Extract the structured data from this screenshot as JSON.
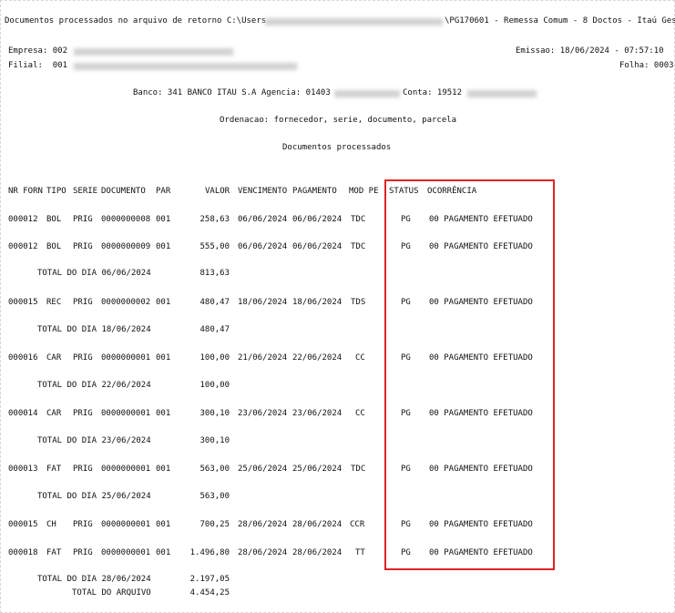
{
  "header": {
    "title_left": "Documentos processados no arquivo de retorno C:\\Users",
    "title_right": "\\PG170601 - Remessa Comum - 8 Doctos - Itaú Ges",
    "empresa_label": "Empresa: 002",
    "filial_label": "Filial:  001",
    "emissao": "Emissao: 18/06/2024 - 07:57:10",
    "folha": "Folha: 0003",
    "banco_label": "Banco: 341 BANCO ITAU S.A Agencia: 01403",
    "conta_label": "Conta: 19512",
    "ordenacao": "Ordenacao: fornecedor, serie, documento, parcela",
    "subtitle": "Documentos processados"
  },
  "columns": {
    "nr_forn": "NR FORN",
    "tipo": "TIPO",
    "serie": "SERIE",
    "documento": "DOCUMENTO",
    "par": "PAR",
    "valor": "VALOR",
    "vencimento": "VENCIMENTO",
    "pagamento": "PAGAMENTO",
    "mod_pe": "MOD PE",
    "status": "STATUS",
    "ocorrencia": "OCORRÊNCIA"
  },
  "rows": [
    {
      "kind": "doc",
      "forn": "000012",
      "tipo": "BOL",
      "serie": "PRIG",
      "doc": "0000000008",
      "par": "001",
      "valor": "258,63",
      "venc": "06/06/2024",
      "pag": "06/06/2024",
      "mod": "TDC",
      "status": "PG",
      "ocorr": "00 PAGAMENTO EFETUADO"
    },
    {
      "kind": "doc",
      "forn": "000012",
      "tipo": "BOL",
      "serie": "PRIG",
      "doc": "0000000009",
      "par": "001",
      "valor": "555,00",
      "venc": "06/06/2024",
      "pag": "06/06/2024",
      "mod": "TDC",
      "status": "PG",
      "ocorr": "00 PAGAMENTO EFETUADO"
    },
    {
      "kind": "total",
      "label": "TOTAL DO DIA 06/06/2024",
      "valor": "813,63"
    },
    {
      "kind": "doc",
      "forn": "000015",
      "tipo": "REC",
      "serie": "PRIG",
      "doc": "0000000002",
      "par": "001",
      "valor": "480,47",
      "venc": "18/06/2024",
      "pag": "18/06/2024",
      "mod": "TDS",
      "status": "PG",
      "ocorr": "00 PAGAMENTO EFETUADO"
    },
    {
      "kind": "total",
      "label": "TOTAL DO DIA 18/06/2024",
      "valor": "480,47"
    },
    {
      "kind": "doc",
      "forn": "000016",
      "tipo": "CAR",
      "serie": "PRIG",
      "doc": "0000000001",
      "par": "001",
      "valor": "100,00",
      "venc": "21/06/2024",
      "pag": "22/06/2024",
      "mod": "CC",
      "status": "PG",
      "ocorr": "00 PAGAMENTO EFETUADO"
    },
    {
      "kind": "total",
      "label": "TOTAL DO DIA 22/06/2024",
      "valor": "100,00"
    },
    {
      "kind": "doc",
      "forn": "000014",
      "tipo": "CAR",
      "serie": "PRIG",
      "doc": "0000000001",
      "par": "001",
      "valor": "300,10",
      "venc": "23/06/2024",
      "pag": "23/06/2024",
      "mod": "CC",
      "status": "PG",
      "ocorr": "00 PAGAMENTO EFETUADO"
    },
    {
      "kind": "total",
      "label": "TOTAL DO DIA 23/06/2024",
      "valor": "300,10"
    },
    {
      "kind": "doc",
      "forn": "000013",
      "tipo": "FAT",
      "serie": "PRIG",
      "doc": "0000000001",
      "par": "001",
      "valor": "563,00",
      "venc": "25/06/2024",
      "pag": "25/06/2024",
      "mod": "TDC",
      "status": "PG",
      "ocorr": "00 PAGAMENTO EFETUADO"
    },
    {
      "kind": "total",
      "label": "TOTAL DO DIA 25/06/2024",
      "valor": "563,00"
    },
    {
      "kind": "doc",
      "forn": "000015",
      "tipo": "CH",
      "serie": "PRIG",
      "doc": "0000000001",
      "par": "001",
      "valor": "700,25",
      "venc": "28/06/2024",
      "pag": "28/06/2024",
      "mod": "CCR",
      "status": "PG",
      "ocorr": "00 PAGAMENTO EFETUADO"
    },
    {
      "kind": "doc",
      "forn": "000018",
      "tipo": "FAT",
      "serie": "PRIG",
      "doc": "0000000001",
      "par": "001",
      "valor": "1.496,80",
      "venc": "28/06/2024",
      "pag": "28/06/2024",
      "mod": "TT",
      "status": "PG",
      "ocorr": "00 PAGAMENTO EFETUADO"
    },
    {
      "kind": "total",
      "label": "TOTAL DO DIA 28/06/2024",
      "valor": "2.197,05"
    }
  ],
  "total_arquivo": {
    "label": "TOTAL DO ARQUIVO",
    "valor": "4.454,25"
  },
  "colors": {
    "highlight": "#e02424"
  }
}
